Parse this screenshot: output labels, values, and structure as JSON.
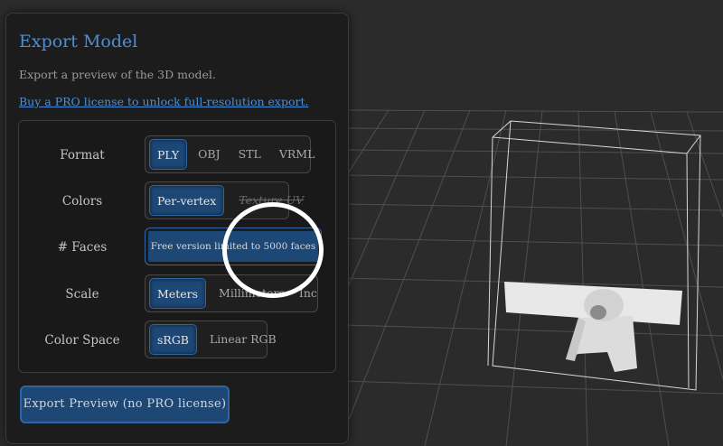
{
  "panel": {
    "title": "Export Model",
    "subtitle": "Export a preview of the 3D model.",
    "pro_link": "Buy a PRO license to unlock full-resolution export."
  },
  "options": {
    "format": {
      "label": "Format",
      "choices": [
        "PLY",
        "OBJ",
        "STL",
        "VRML"
      ],
      "selected": "PLY"
    },
    "colors": {
      "label": "Colors",
      "choices": [
        "Per-vertex",
        "Texture UV"
      ],
      "selected": "Per-vertex",
      "disabled": [
        "Texture UV"
      ]
    },
    "faces": {
      "label": "# Faces",
      "button_text": "Free version limited to 5000 faces"
    },
    "scale": {
      "label": "Scale",
      "choices": [
        "Meters",
        "Millimeters",
        "Inches"
      ],
      "selected": "Meters"
    },
    "color_space": {
      "label": "Color Space",
      "choices": [
        "sRGB",
        "Linear RGB"
      ],
      "selected": "sRGB"
    }
  },
  "export_button": "Export Preview (no PRO license)",
  "colors": {
    "accent": "#4a8fd9",
    "button_bg": "#1d4775",
    "panel_bg": "#1c1c1c",
    "viewport_bg": "#2b2b2b",
    "grid": "#555555",
    "highlight": "#ffffff"
  }
}
